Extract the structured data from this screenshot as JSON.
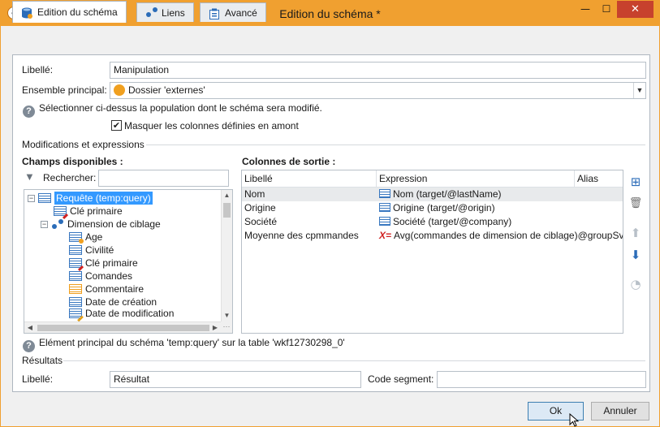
{
  "window": {
    "title": "Edition du schéma *",
    "app_icon": "adobe-campaign-icon",
    "controls": {
      "minimize": "—",
      "maximize": "☐",
      "close": "✕"
    },
    "accent": "#f0a030",
    "close_color": "#c7412d"
  },
  "tabs": [
    {
      "label": "Edition du schéma",
      "icon": "schema-icon",
      "active": true
    },
    {
      "label": "Liens",
      "icon": "link-icon",
      "active": false
    },
    {
      "label": "Avancé",
      "icon": "advanced-icon",
      "active": false
    }
  ],
  "form": {
    "libelle_label": "Libellé:",
    "libelle_value": "Manipulation",
    "ensemble_label": "Ensemble principal:",
    "ensemble_value": "Dossier 'externes'",
    "info_text": "Sélectionner ci-dessus la population dont le schéma sera modifié.",
    "mask_checkbox_label": "Masquer les colonnes définies en amont",
    "mask_checked": true,
    "mask_check_glyph": "✔"
  },
  "modifications": {
    "section_title": "Modifications et expressions",
    "available_fields_title": "Champs disponibles :",
    "search_label": "Rechercher:",
    "search_value": "",
    "tree": [
      {
        "label": "Requête (temp:query)",
        "level": 0,
        "expander": "−",
        "icon": "list-icon",
        "selected": true
      },
      {
        "label": "Clé primaire",
        "level": 1,
        "icon": "key-field-icon"
      },
      {
        "label": "Dimension de ciblage",
        "level": 1,
        "expander": "−",
        "icon": "link-icon"
      },
      {
        "label": "Age",
        "level": 2,
        "icon": "computed-field-icon"
      },
      {
        "label": "Civilité",
        "level": 2,
        "icon": "list-icon"
      },
      {
        "label": "Clé primaire",
        "level": 2,
        "icon": "key-field-icon"
      },
      {
        "label": "Comandes",
        "level": 2,
        "icon": "list-icon"
      },
      {
        "label": "Commentaire",
        "level": 2,
        "icon": "memo-field-icon"
      },
      {
        "label": "Date de création",
        "level": 2,
        "icon": "list-icon"
      },
      {
        "label": "Date de modification",
        "level": 2,
        "icon": "date-edit-icon"
      }
    ],
    "output_columns_title": "Colonnes de sortie :",
    "grid_headers": {
      "libelle": "Libellé",
      "expression": "Expression",
      "alias": "Alias"
    },
    "grid_rows": [
      {
        "libelle": "Nom",
        "expression": "Nom (target/@lastName)",
        "expr_icon": "list-icon",
        "alias": "",
        "selected": true
      },
      {
        "libelle": "Origine",
        "expression": "Origine (target/@origin)",
        "expr_icon": "list-icon",
        "alias": ""
      },
      {
        "libelle": "Société",
        "expression": "Société (target/@company)",
        "expr_icon": "list-icon",
        "alias": ""
      },
      {
        "libelle": "Moyenne des cpmmandes",
        "expression": "Avg(commandes de dimension de ciblage)@groupSv",
        "expr_icon": "expression-icon",
        "expr_glyph": "X=",
        "alias": ""
      }
    ],
    "side_tools": [
      {
        "name": "add-column-icon",
        "glyph": "⊞",
        "color": "#2b6cb8"
      },
      {
        "name": "delete-icon",
        "glyph": "🗑",
        "color": "#707070"
      },
      {
        "name": "move-up-icon",
        "glyph": "⬆",
        "color": "#b8c0c8"
      },
      {
        "name": "move-down-icon",
        "glyph": "⬇",
        "color": "#2b6cb8"
      },
      {
        "name": "distribution-icon",
        "glyph": "◔",
        "color": "#b8c0c8"
      }
    ],
    "footer_info": "Elément principal du schéma 'temp:query' sur la table 'wkf12730298_0'"
  },
  "results": {
    "section_title": "Résultats",
    "libelle_label": "Libellé:",
    "libelle_value": "Résultat",
    "code_segment_label": "Code segment:",
    "code_segment_value": ""
  },
  "buttons": {
    "ok": "Ok",
    "cancel": "Annuler"
  }
}
